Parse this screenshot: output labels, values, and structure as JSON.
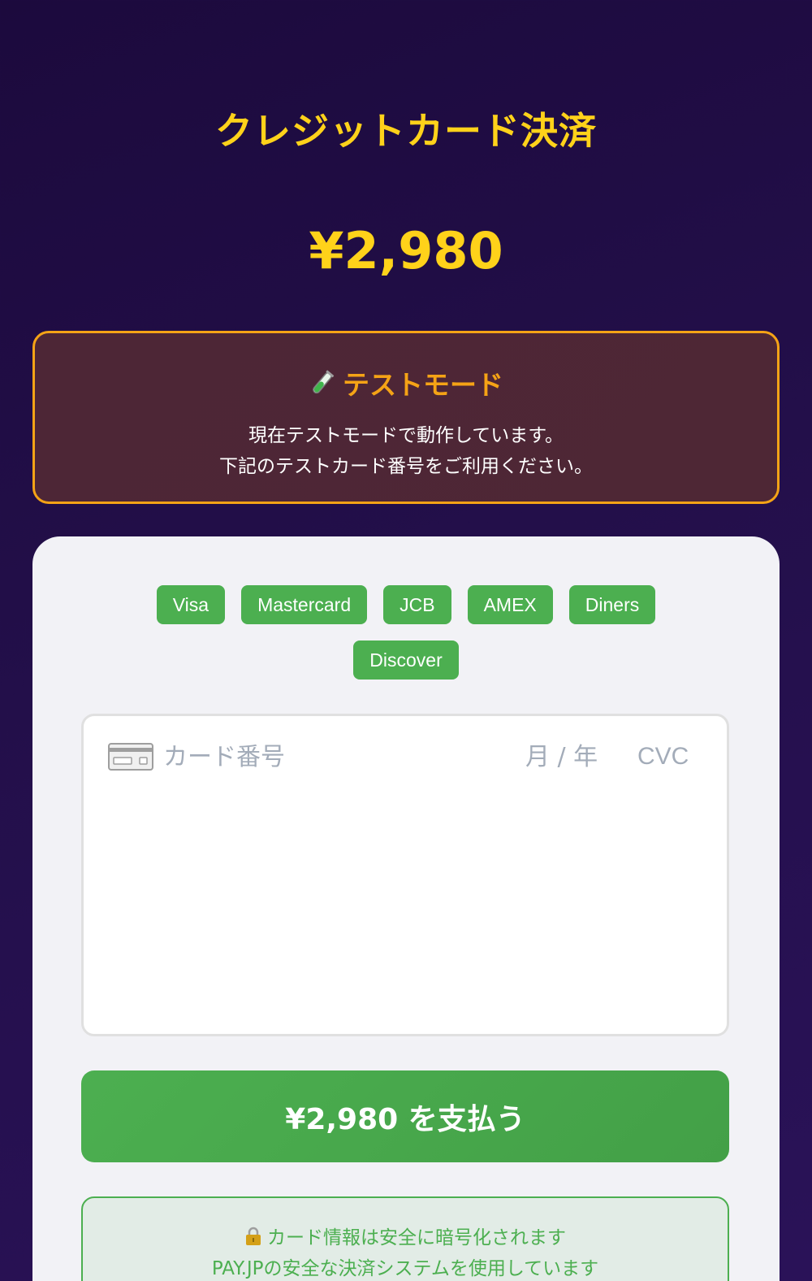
{
  "header": {
    "title": "クレジットカード決済",
    "price": "¥2,980"
  },
  "test_mode": {
    "icon": "test-tube-icon",
    "title": "テストモード",
    "line1": "現在テストモードで動作しています。",
    "line2": "下記のテストカード番号をご利用ください。"
  },
  "brands": [
    "Visa",
    "Mastercard",
    "JCB",
    "AMEX",
    "Diners",
    "Discover"
  ],
  "card_form": {
    "card_icon": "credit-card-icon",
    "card_number_placeholder": "カード番号",
    "expiry_placeholder": "月 / 年",
    "cvc_placeholder": "CVC"
  },
  "pay_button": {
    "label": "¥2,980 を支払う"
  },
  "security": {
    "icon": "lock-icon",
    "line1": "カード情報は安全に暗号化されます",
    "line2": "PAY.JPの安全な決済システムを使用しています"
  },
  "colors": {
    "accent_yellow": "#ffd21a",
    "warning_orange": "#f5a316",
    "success_green": "#4caf50",
    "background_dark": "#1c0a3d"
  }
}
